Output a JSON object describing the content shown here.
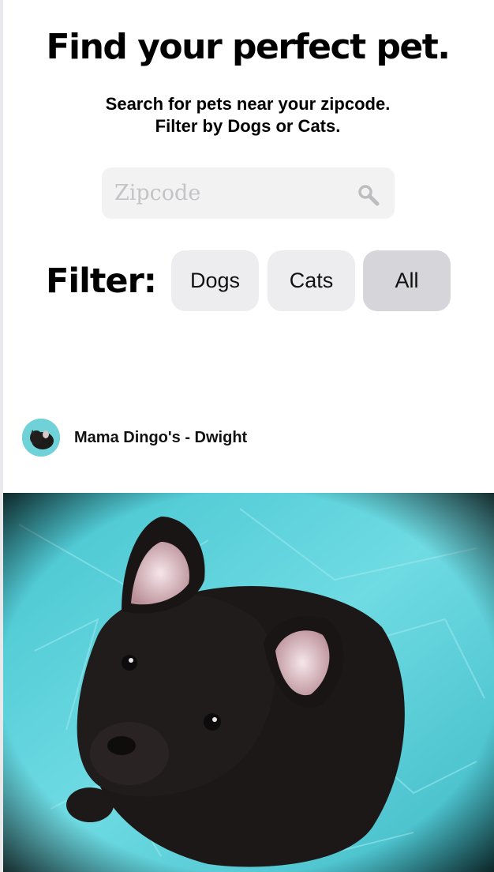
{
  "header": {
    "title": "Find your perfect pet.",
    "subtitle_line1": "Search for pets near your zipcode.",
    "subtitle_line2": "Filter by Dogs or Cats."
  },
  "search": {
    "placeholder": "Zipcode",
    "value": "",
    "icon": "search-icon"
  },
  "filter": {
    "label": "Filter:",
    "options": [
      {
        "label": "Dogs",
        "selected": false
      },
      {
        "label": "Cats",
        "selected": false
      },
      {
        "label": "All",
        "selected": true
      }
    ]
  },
  "post": {
    "author": "Mama Dingo's - Dwight",
    "photo_subject": "black puppy on teal tarp"
  },
  "colors": {
    "button_bg": "#ededf0",
    "button_active_bg": "#d5d5da",
    "input_bg": "#f2f2f3",
    "photo_bg": "#4fd0dc"
  }
}
